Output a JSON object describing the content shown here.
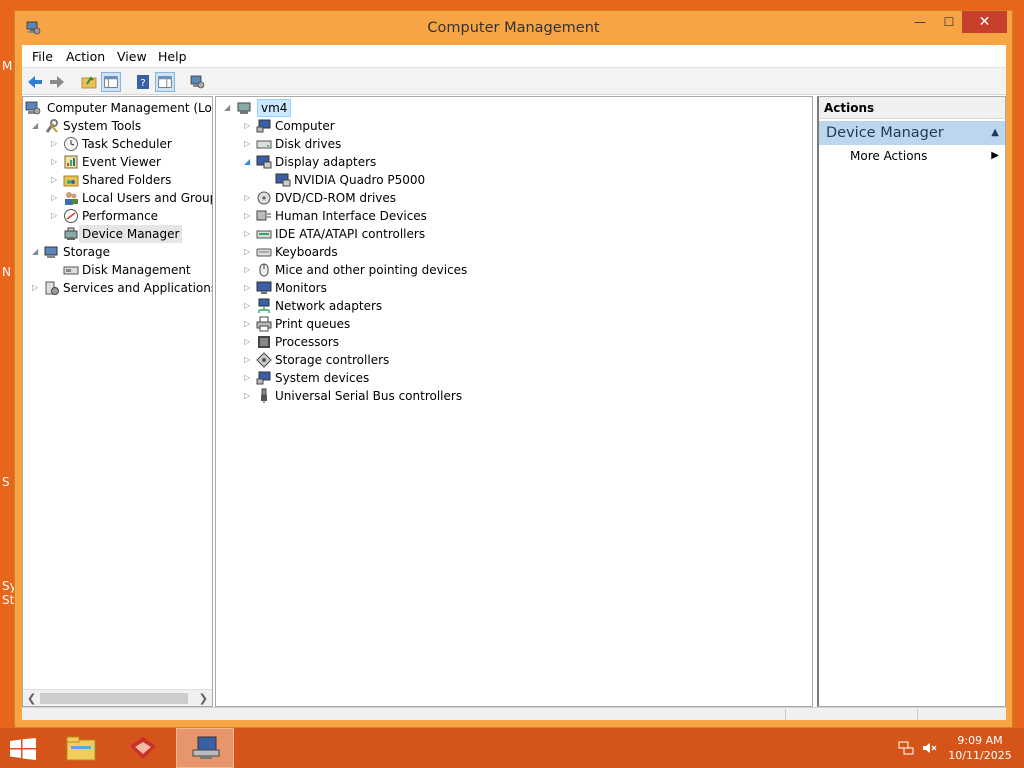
{
  "window": {
    "title": "Computer Management"
  },
  "menu": [
    "File",
    "Action",
    "View",
    "Help"
  ],
  "toolbar": [
    "back-icon",
    "forward-icon",
    "up-folder-icon",
    "show-hide-tree-icon",
    "help-icon",
    "properties-icon",
    "computer-icon"
  ],
  "left_tree": {
    "root": "Computer Management (Local",
    "system_tools": "System Tools",
    "items": [
      "Task Scheduler",
      "Event Viewer",
      "Shared Folders",
      "Local Users and Groups",
      "Performance",
      "Device Manager"
    ],
    "storage": "Storage",
    "disk_management": "Disk Management",
    "services": "Services and Applications"
  },
  "device_tree": {
    "root": "vm4",
    "categories": [
      "Computer",
      "Disk drives",
      "Display adapters",
      "DVD/CD-ROM drives",
      "Human Interface Devices",
      "IDE ATA/ATAPI controllers",
      "Keyboards",
      "Mice and other pointing devices",
      "Monitors",
      "Network adapters",
      "Print queues",
      "Processors",
      "Storage controllers",
      "System devices",
      "Universal Serial Bus controllers"
    ],
    "display_child": "NVIDIA Quadro P5000"
  },
  "actions": {
    "header": "Actions",
    "section": "Device Manager",
    "more": "More Actions"
  },
  "taskbar": {
    "time": "9:09 AM",
    "date": "10/11/2025"
  },
  "desktop_labels": [
    "M",
    "N",
    "S",
    "Sy",
    "St"
  ],
  "colors": {
    "desktop": "#e8661c",
    "titlebar": "#f6a444",
    "close": "#c7402e",
    "taskbar": "#d5541a",
    "actions_section": "#bcd6ee"
  }
}
